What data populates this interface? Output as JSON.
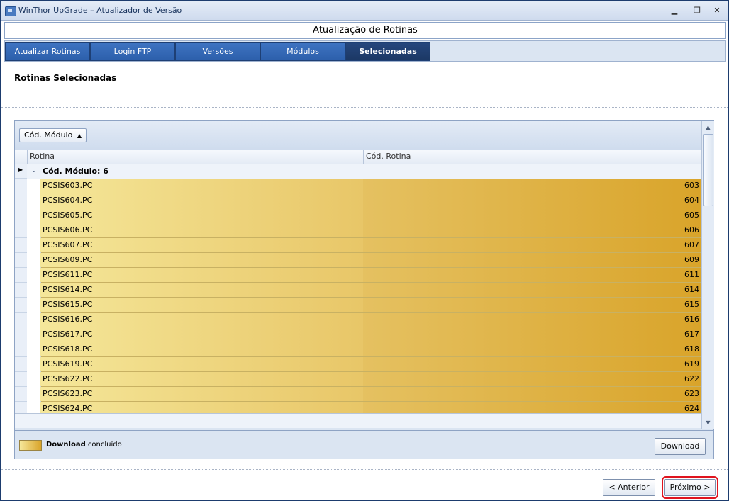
{
  "window": {
    "title": "WinThor UpGrade – Atualizador de Versão"
  },
  "header": {
    "title": "Atualização de Rotinas"
  },
  "tabs": [
    {
      "label": "Atualizar Rotinas"
    },
    {
      "label": "Login FTP"
    },
    {
      "label": "Versões"
    },
    {
      "label": "Módulos"
    },
    {
      "label": "Selecionadas",
      "active": true
    }
  ],
  "section": {
    "title": "Rotinas Selecionadas"
  },
  "grid": {
    "group_chip": "Cód. Módulo",
    "columns": [
      "Rotina",
      "Cód. Rotina"
    ],
    "group_row": "Cód. Módulo: 6",
    "rows": [
      {
        "rotina": "PCSIS603.PC",
        "codigo": "603"
      },
      {
        "rotina": "PCSIS604.PC",
        "codigo": "604"
      },
      {
        "rotina": "PCSIS605.PC",
        "codigo": "605"
      },
      {
        "rotina": "PCSIS606.PC",
        "codigo": "606"
      },
      {
        "rotina": "PCSIS607.PC",
        "codigo": "607"
      },
      {
        "rotina": "PCSIS609.PC",
        "codigo": "609"
      },
      {
        "rotina": "PCSIS611.PC",
        "codigo": "611"
      },
      {
        "rotina": "PCSIS614.PC",
        "codigo": "614"
      },
      {
        "rotina": "PCSIS615.PC",
        "codigo": "615"
      },
      {
        "rotina": "PCSIS616.PC",
        "codigo": "616"
      },
      {
        "rotina": "PCSIS617.PC",
        "codigo": "617"
      },
      {
        "rotina": "PCSIS618.PC",
        "codigo": "618"
      },
      {
        "rotina": "PCSIS619.PC",
        "codigo": "619"
      },
      {
        "rotina": "PCSIS622.PC",
        "codigo": "622"
      },
      {
        "rotina": "PCSIS623.PC",
        "codigo": "623"
      },
      {
        "rotina": "PCSIS624.PC",
        "codigo": "624"
      }
    ]
  },
  "legend": {
    "bold": "Download",
    "text": "concluído"
  },
  "buttons": {
    "download": "Download",
    "anterior": "< Anterior",
    "proximo": "Próximo >"
  },
  "colors": {
    "tab_bg": "#2c5fab",
    "tab_active": "#1c3865",
    "row_light": "#f5e79a",
    "row_dark": "#d9a42a",
    "highlight": "#e0141e"
  }
}
